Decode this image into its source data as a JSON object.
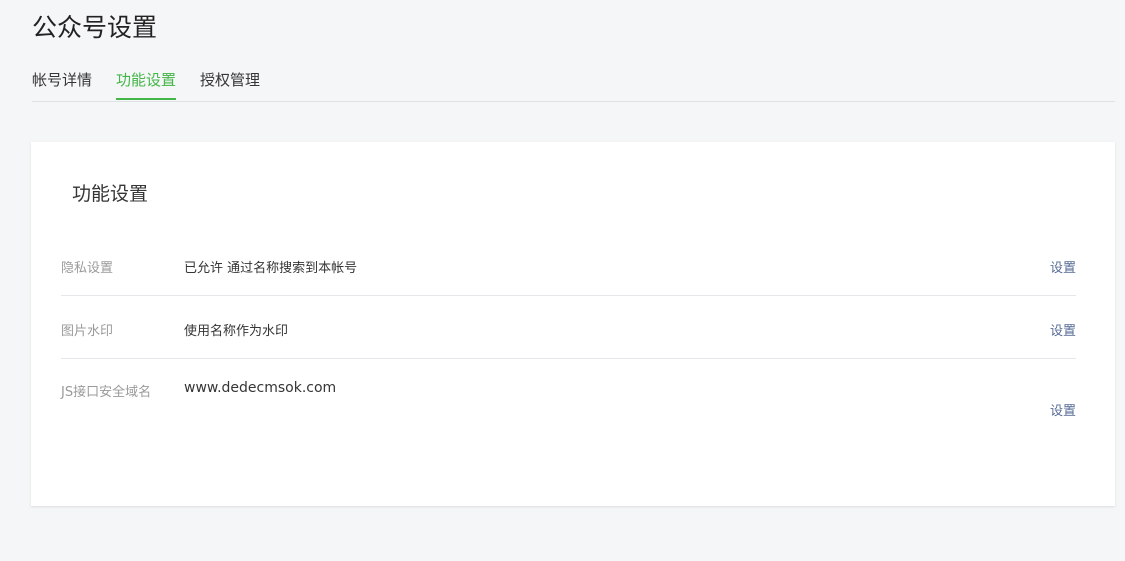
{
  "header": {
    "title": "公众号设置"
  },
  "tabs": [
    {
      "label": "帐号详情",
      "active": false
    },
    {
      "label": "功能设置",
      "active": true
    },
    {
      "label": "授权管理",
      "active": false
    }
  ],
  "colors": {
    "accent": "#44b549",
    "link": "#576b95",
    "background": "#f5f6f7"
  },
  "card": {
    "title": "功能设置",
    "rows": [
      {
        "label": "隐私设置",
        "value": "已允许 通过名称搜索到本帐号",
        "action": "设置"
      },
      {
        "label": "图片水印",
        "value": "使用名称作为水印",
        "action": "设置"
      },
      {
        "label": "JS接口安全域名",
        "value": "www.dedecmsok.com",
        "action": "设置"
      }
    ]
  }
}
